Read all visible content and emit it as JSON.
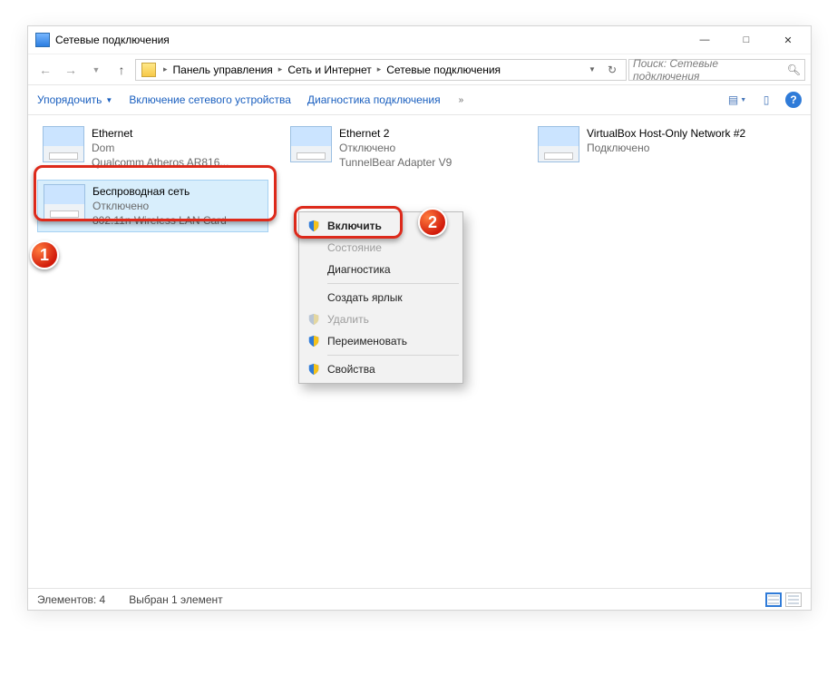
{
  "window": {
    "title": "Сетевые подключения"
  },
  "breadcrumb": {
    "item0": "Панель управления",
    "item1": "Сеть и Интернет",
    "item2": "Сетевые подключения"
  },
  "search": {
    "placeholder": "Поиск: Сетевые подключения"
  },
  "commands": {
    "organize": "Упорядочить",
    "enable_device": "Включение сетевого устройства",
    "diagnostics": "Диагностика подключения"
  },
  "connections": [
    {
      "name": "Ethernet",
      "status": "Dom",
      "adapter": "Qualcomm Atheros AR816..."
    },
    {
      "name": "Ethernet 2",
      "status": "Отключено",
      "adapter": "TunnelBear Adapter V9"
    },
    {
      "name": "VirtualBox Host-Only Network #2",
      "status": "Подключено",
      "adapter": ""
    },
    {
      "name": "Беспроводная сеть",
      "status": "Отключено",
      "adapter": "802.11n Wireless LAN Card"
    }
  ],
  "ctxmenu": {
    "enable": "Включить",
    "status": "Состояние",
    "diag": "Диагностика",
    "shortcut": "Создать ярлык",
    "delete": "Удалить",
    "rename": "Переименовать",
    "props": "Свойства"
  },
  "statusbar": {
    "count_label": "Элементов:",
    "count_value": "4",
    "selection": "Выбран 1 элемент"
  },
  "badges": {
    "one": "1",
    "two": "2"
  }
}
